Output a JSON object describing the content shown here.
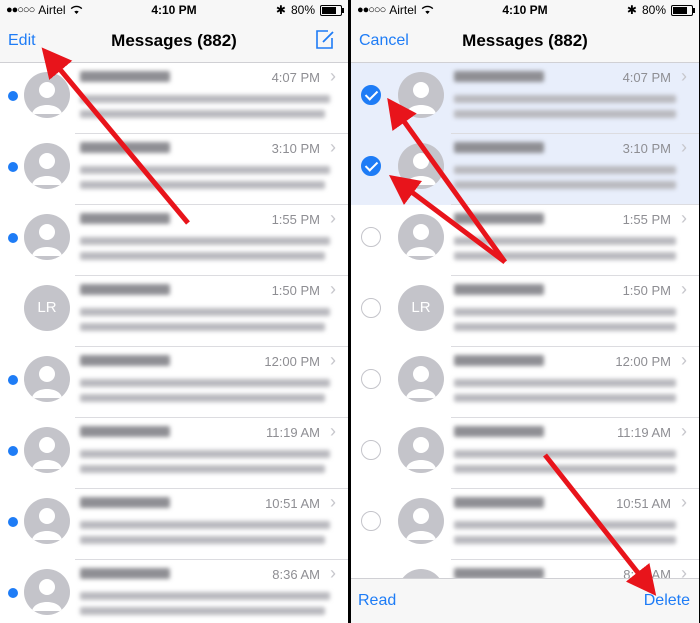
{
  "status_bar": {
    "carrier": "Airtel",
    "time": "4:10 PM",
    "battery": "80%",
    "battery_level": 0.8
  },
  "left_screen": {
    "nav": {
      "edit_label": "Edit",
      "title": "Messages (882)",
      "compose_icon": "compose-icon"
    },
    "rows": [
      {
        "time": "4:07 PM",
        "unread": true,
        "avatar": "person"
      },
      {
        "time": "3:10 PM",
        "unread": true,
        "avatar": "person"
      },
      {
        "time": "1:55 PM",
        "unread": true,
        "avatar": "person"
      },
      {
        "time": "1:50 PM",
        "unread": false,
        "avatar": "initials",
        "initials": "LR"
      },
      {
        "time": "12:00 PM",
        "unread": true,
        "avatar": "person"
      },
      {
        "time": "11:19 AM",
        "unread": true,
        "avatar": "person"
      },
      {
        "time": "10:51 AM",
        "unread": true,
        "avatar": "person"
      },
      {
        "time": "8:36 AM",
        "unread": true,
        "avatar": "person"
      }
    ]
  },
  "right_screen": {
    "nav": {
      "cancel_label": "Cancel",
      "title": "Messages (882)"
    },
    "rows": [
      {
        "time": "4:07 PM",
        "selected": true,
        "avatar": "person"
      },
      {
        "time": "3:10 PM",
        "selected": true,
        "avatar": "person"
      },
      {
        "time": "1:55 PM",
        "selected": false,
        "avatar": "person"
      },
      {
        "time": "1:50 PM",
        "selected": false,
        "avatar": "initials",
        "initials": "LR"
      },
      {
        "time": "12:00 PM",
        "selected": false,
        "avatar": "person"
      },
      {
        "time": "11:19 AM",
        "selected": false,
        "avatar": "person"
      },
      {
        "time": "10:51 AM",
        "selected": false,
        "avatar": "person"
      },
      {
        "time": "8:36 AM",
        "selected": false,
        "avatar": "person"
      }
    ],
    "toolbar": {
      "read_label": "Read",
      "delete_label": "Delete"
    }
  },
  "colors": {
    "accent": "#1e7cf6",
    "annotation_arrow": "#e8141b",
    "selected_row": "#e8eefb"
  }
}
